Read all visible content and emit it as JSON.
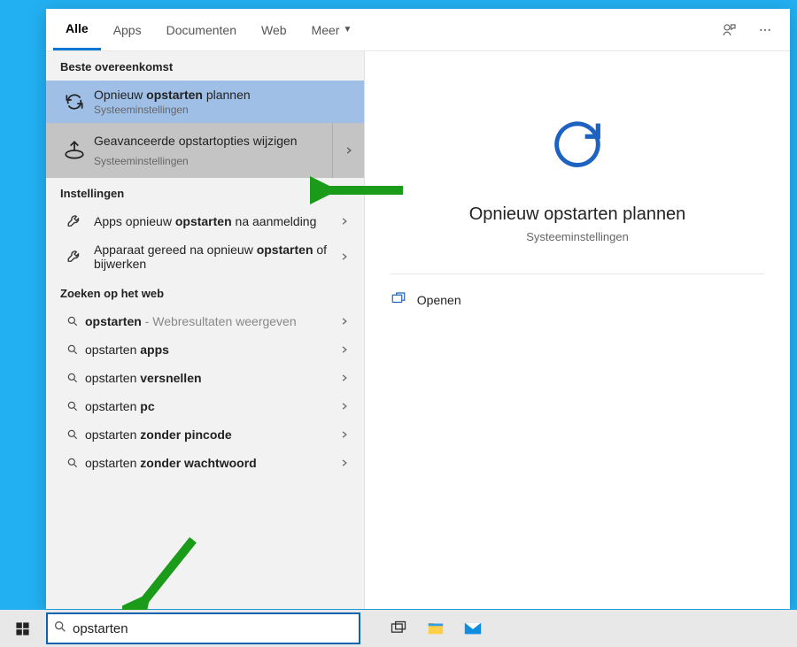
{
  "tabs": {
    "all": "Alle",
    "apps": "Apps",
    "documents": "Documenten",
    "web": "Web",
    "more": "Meer"
  },
  "sections": {
    "best_match": "Beste overeenkomst",
    "settings": "Instellingen",
    "web_search": "Zoeken op het web"
  },
  "results": {
    "best1": {
      "pre": "Opnieuw ",
      "bold": "opstarten",
      "post": " plannen",
      "sub": "Systeeminstellingen"
    },
    "best2": {
      "title": "Geavanceerde opstartopties wijzigen",
      "sub": "Systeeminstellingen"
    },
    "set1": {
      "pre": "Apps opnieuw ",
      "bold": "opstarten",
      "post": " na aanmelding"
    },
    "set2": {
      "pre": "Apparaat gereed na opnieuw ",
      "bold": "opstarten",
      "post": " of bijwerken"
    },
    "web_items": [
      {
        "pre": "",
        "bold": "opstarten",
        "post": "",
        "dim": " - Webresultaten weergeven"
      },
      {
        "pre": "opstarten ",
        "bold": "apps",
        "post": ""
      },
      {
        "pre": "opstarten ",
        "bold": "versnellen",
        "post": ""
      },
      {
        "pre": "opstarten ",
        "bold": "pc",
        "post": ""
      },
      {
        "pre": "opstarten ",
        "bold": "zonder pincode",
        "post": ""
      },
      {
        "pre": "opstarten ",
        "bold": "zonder wachtwoord",
        "post": ""
      }
    ]
  },
  "preview": {
    "title": "Opnieuw opstarten plannen",
    "sub": "Systeeminstellingen",
    "open": "Openen"
  },
  "search": {
    "value": "opstarten"
  }
}
